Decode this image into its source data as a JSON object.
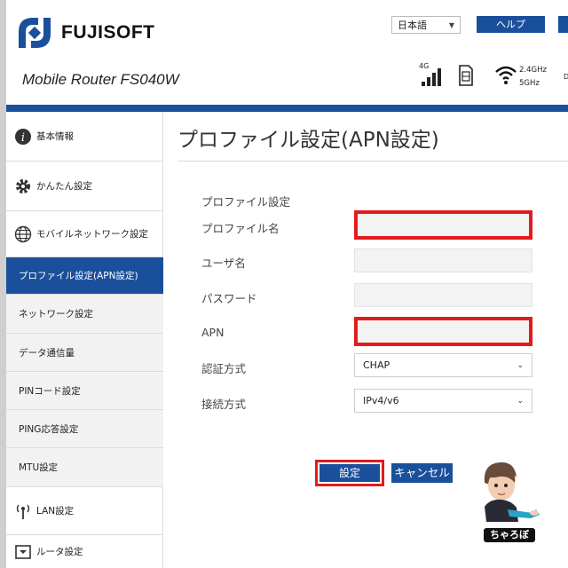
{
  "header": {
    "brand": "FUJISOFT",
    "product": "Mobile Router FS040W",
    "language": "日本語",
    "help_label": "ヘルプ",
    "network_type": "4G",
    "band_24": "2.4GHz",
    "band_5": "5GHz",
    "band_extra": "D",
    "colors": {
      "primary": "#1a4f9c",
      "highlight": "#e31b1b"
    }
  },
  "sidebar": {
    "items": [
      {
        "label": "基本情報",
        "icon": "info-icon"
      },
      {
        "label": "かんたん設定",
        "icon": "gear-icon"
      },
      {
        "label": "モバイルネットワーク設定",
        "icon": "globe-icon"
      },
      {
        "label": "プロファイル設定(APN設定)",
        "active": true
      },
      {
        "label": "ネットワーク設定"
      },
      {
        "label": "データ通信量"
      },
      {
        "label": "PINコード設定"
      },
      {
        "label": "PING応答設定"
      },
      {
        "label": "MTU設定"
      },
      {
        "label": "LAN設定",
        "icon": "antenna-icon"
      },
      {
        "label": "ルータ設定",
        "icon": "router-icon"
      }
    ]
  },
  "main": {
    "title": "プロファイル設定(APN設定)",
    "section_label": "プロファイル設定",
    "fields": {
      "profile_name": {
        "label": "プロファイル名",
        "value": ""
      },
      "username": {
        "label": "ユーザ名",
        "value": ""
      },
      "password": {
        "label": "パスワード",
        "value": ""
      },
      "apn": {
        "label": "APN",
        "value": ""
      },
      "auth": {
        "label": "認証方式",
        "value": "CHAP"
      },
      "connection": {
        "label": "接続方式",
        "value": "IPv4/v6"
      }
    },
    "save_label": "設定",
    "cancel_label": "キャンセル"
  },
  "mascot": {
    "label": "ちゃろぼ"
  }
}
